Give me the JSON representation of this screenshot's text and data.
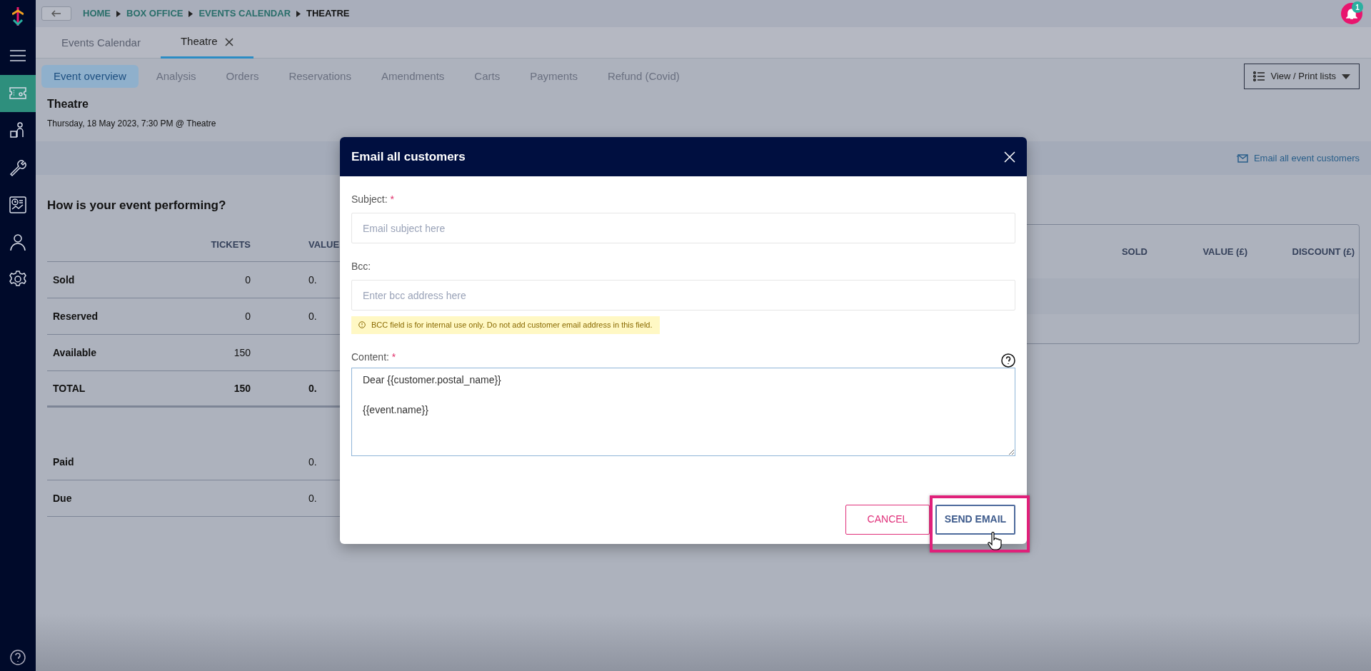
{
  "breadcrumb": [
    {
      "label": "HOME",
      "current": false
    },
    {
      "label": "BOX OFFICE",
      "current": false
    },
    {
      "label": "EVENTS CALENDAR",
      "current": false
    },
    {
      "label": "THEATRE",
      "current": true
    }
  ],
  "notifications": {
    "count": "1"
  },
  "sidebar": {
    "items": [
      {
        "kind": "menu",
        "selected": false
      },
      {
        "kind": "ticket",
        "selected": true
      },
      {
        "kind": "person-bag",
        "selected": false
      },
      {
        "kind": "wrench",
        "selected": false
      },
      {
        "kind": "report",
        "selected": false
      },
      {
        "kind": "person",
        "selected": false
      },
      {
        "kind": "gear",
        "selected": false
      }
    ]
  },
  "page_tabs": [
    {
      "label": "Events Calendar",
      "selected": false,
      "closable": false
    },
    {
      "label": "Theatre",
      "selected": true,
      "closable": true
    }
  ],
  "subnav": [
    {
      "label": "Event overview",
      "selected": true
    },
    {
      "label": "Analysis",
      "selected": false
    },
    {
      "label": "Orders",
      "selected": false
    },
    {
      "label": "Reservations",
      "selected": false
    },
    {
      "label": "Amendments",
      "selected": false
    },
    {
      "label": "Carts",
      "selected": false
    },
    {
      "label": "Payments",
      "selected": false
    },
    {
      "label": "Refund (Covid)",
      "selected": false
    }
  ],
  "view_print_button": "View / Print lists",
  "event": {
    "title": "Theatre",
    "date": "Thursday, 18 May 2023, 7:30 PM @ Theatre"
  },
  "email_link": "Email all event customers",
  "performance": {
    "title": "How is your event performing?",
    "columns": [
      "TICKETS",
      "VALUE"
    ],
    "rows": [
      {
        "label": "Sold",
        "tickets": "0",
        "value": "0.",
        "kind": "normal"
      },
      {
        "label": "Reserved",
        "tickets": "0",
        "value": "0.",
        "kind": "normal"
      },
      {
        "label": "Available",
        "tickets": "150",
        "kind": "normal"
      },
      {
        "label": "TOTAL",
        "tickets": "150",
        "value": "0.",
        "kind": "total"
      }
    ],
    "payment_rows": [
      {
        "label": "Paid",
        "value": "0."
      },
      {
        "label": "Due",
        "value": "0."
      }
    ]
  },
  "sales_table": {
    "columns": [
      "SOLD",
      "VALUE (£)",
      "DISCOUNT (£)"
    ]
  },
  "modal": {
    "title": "Email all customers",
    "fields": [
      {
        "label": "Subject:",
        "required_mark": "*",
        "placeholder": "Email subject here"
      },
      {
        "label": "Bcc:",
        "placeholder": "Enter bcc address here",
        "warning": "BCC field is for internal use only. Do not add customer email address in this field."
      }
    ],
    "content": {
      "label": "Content:",
      "required_mark": "*",
      "value": "Dear {{customer.postal_name}}\n\n{{event.name}}"
    },
    "buttons": [
      {
        "label": "CANCEL",
        "kind": "secondary",
        "highlighted": false
      },
      {
        "label": "SEND EMAIL",
        "kind": "primary",
        "highlighted": true
      }
    ]
  }
}
